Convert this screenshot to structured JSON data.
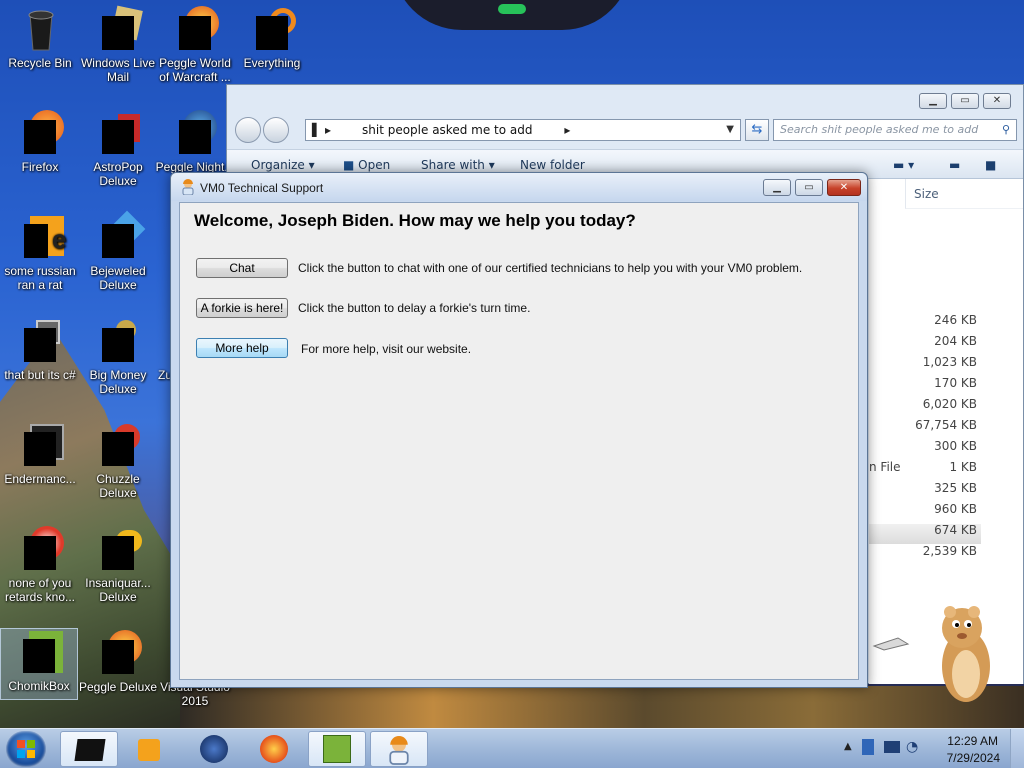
{
  "desktop": {
    "icons": [
      {
        "label": "Recycle Bin",
        "icon": "recycle-bin-icon"
      },
      {
        "label": "Windows Live Mail",
        "icon": "windows-live-mail-icon"
      },
      {
        "label": "Peggle World of Warcraft ...",
        "icon": "peggle-wow-icon"
      },
      {
        "label": "Everything",
        "icon": "everything-search-icon"
      },
      {
        "label": "Firefox",
        "icon": "firefox-icon"
      },
      {
        "label": "AstroPop Deluxe",
        "icon": "astropop-icon"
      },
      {
        "label": "Peggle Night...",
        "icon": "peggle-nights-icon"
      },
      {
        "label": "some russian ran a rat",
        "icon": "document-icon"
      },
      {
        "label": "Bejeweled Deluxe",
        "icon": "bejeweled-icon"
      },
      {
        "label": "that but its c#",
        "icon": "folder-icon"
      },
      {
        "label": "Big Money Deluxe",
        "icon": "big-money-icon"
      },
      {
        "label": "Zu",
        "icon": "zuma-icon"
      },
      {
        "label": "Endermanc...",
        "icon": "endermanch-icon"
      },
      {
        "label": "Chuzzle Deluxe",
        "icon": "chuzzle-icon"
      },
      {
        "label": "none of you retards kno...",
        "icon": "shortcut-icon"
      },
      {
        "label": "Insaniquar... Deluxe",
        "icon": "insaniquarium-icon"
      },
      {
        "label": "ChomikBox",
        "icon": "chomikbox-icon"
      },
      {
        "label": "Peggle Deluxe",
        "icon": "peggle-icon"
      },
      {
        "label": "Visual Studio 2015",
        "icon": "visual-studio-icon"
      }
    ]
  },
  "explorer": {
    "address": "shit people asked me to add",
    "search_placeholder": "Search shit people asked me to add",
    "commands": [
      "Organize ▾",
      "Open",
      "Share with ▾",
      "New folder"
    ],
    "column_size": "Size",
    "sizes": [
      "246 KB",
      "204 KB",
      "1,023 KB",
      "170 KB",
      "6,020 KB",
      "67,754 KB",
      "300 KB",
      "1 KB",
      "325 KB",
      "960 KB",
      "674 KB",
      "2,539 KB"
    ],
    "type_fragment": "n File"
  },
  "dialog": {
    "title": "VM0 Technical Support",
    "heading": "Welcome, Joseph Biden. How may we help you today?",
    "chat_button": "Chat",
    "chat_desc": "Click the button to chat with one of our certified technicians to help you with your VM0 problem.",
    "forkie_button": "A forkie is here!",
    "forkie_desc": "Click the button to delay a forkie's turn time.",
    "help_button": "More help",
    "help_desc": "For more help, visit our website."
  },
  "taskbar": {
    "time": "12:29 AM",
    "date": "7/29/2024",
    "items": [
      "chomikbox-taskbar",
      "media-player",
      "browser-globe",
      "firefox",
      "chomikbox",
      "vm0-support"
    ]
  },
  "colors": {
    "accent": "#3c7fb1",
    "close_red": "#c7422a",
    "taskbar": "#9fb8d9"
  }
}
